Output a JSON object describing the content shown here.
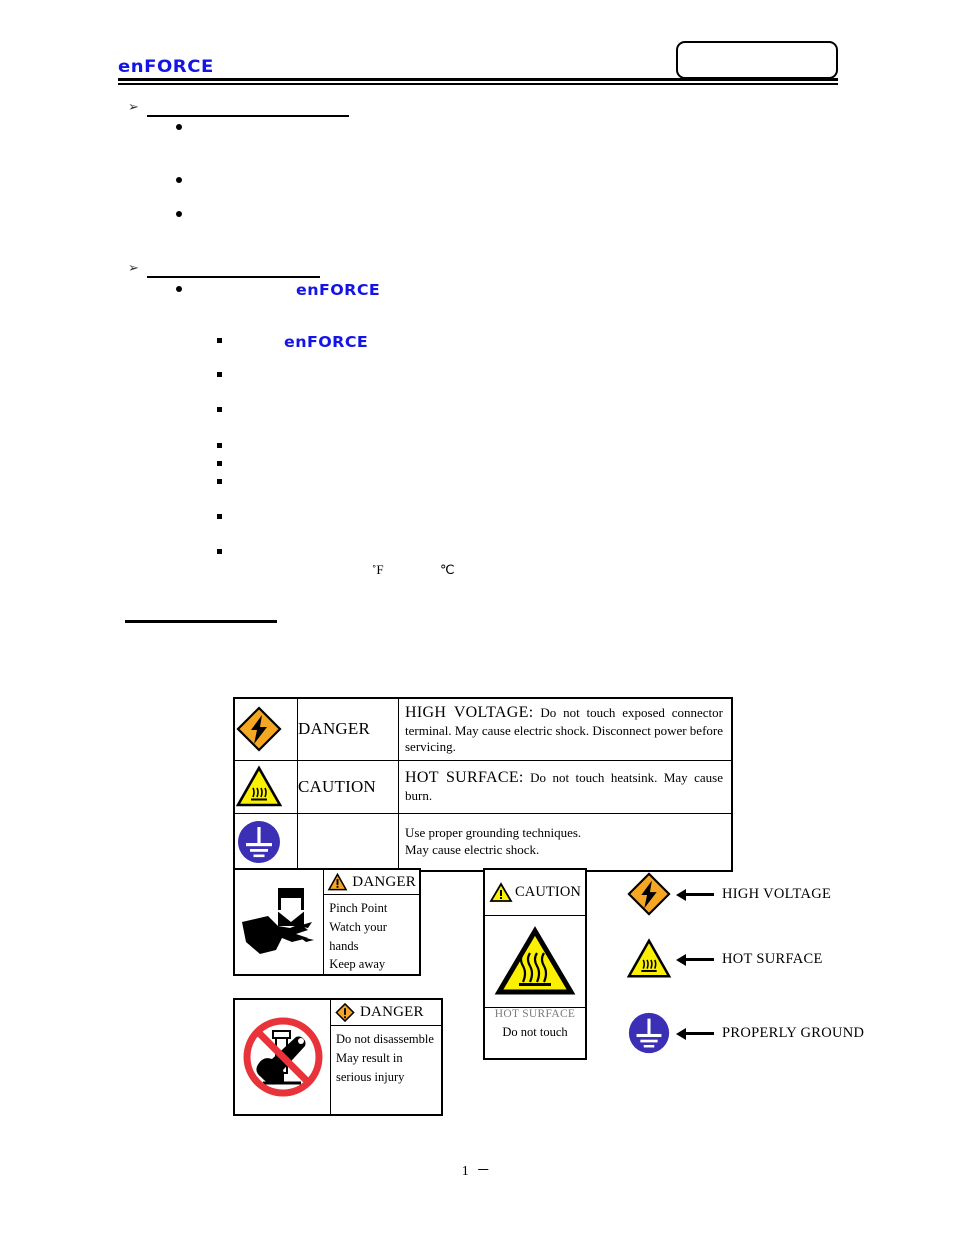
{
  "header": {
    "logo_text": "enFORCE",
    "logo_color": "#1414e6",
    "title_box_value": ""
  },
  "body": {
    "sections": [
      {
        "marker": "➢",
        "heading": "",
        "bullets": [
          {
            "marker": "●",
            "text": ""
          },
          {
            "marker": "●",
            "text": ""
          },
          {
            "marker": "●",
            "text": ""
          }
        ]
      },
      {
        "marker": "➢",
        "heading": "",
        "bullets": [
          {
            "marker": "●",
            "text": "",
            "logo": "enFORCE"
          }
        ],
        "subbullets": [
          {
            "marker": "▪",
            "text": "",
            "logo": "enFORCE"
          },
          {
            "marker": "▪",
            "text": ""
          },
          {
            "marker": "▪",
            "text": ""
          },
          {
            "marker": "▪",
            "text": ""
          },
          {
            "marker": "▪",
            "text": ""
          },
          {
            "marker": "▪",
            "text": ""
          },
          {
            "marker": "▪",
            "text": ""
          },
          {
            "marker": "▪",
            "text": ""
          }
        ]
      }
    ],
    "temperature_units": {
      "fahrenheit": "˚F",
      "celsius": "℃"
    },
    "section_heading_rule": ""
  },
  "warning_table": {
    "rows": [
      {
        "icon": "high-voltage-diamond-icon",
        "signal_word": "DANGER",
        "lead": "HIGH  VOLTAGE:",
        "text": " Do not touch exposed connector terminal. May cause electric shock. Disconnect power before servicing."
      },
      {
        "icon": "hot-surface-triangle-icon",
        "signal_word": "CAUTION",
        "lead": "HOT SURFACE:",
        "text": " Do not touch heatsink. May cause burn."
      },
      {
        "icon": "protective-ground-circle-icon",
        "signal_word": "",
        "lead": "",
        "text_line1": "Use proper grounding techniques.",
        "text_line2": "May cause electric shock."
      }
    ]
  },
  "labels": {
    "pinch": {
      "icon": "pinch-point-hand-icon",
      "signal_icon": "warning-triangle-icon",
      "signal_word": "DANGER",
      "lines": [
        "Pinch Point",
        "Watch your hands",
        "Keep away"
      ]
    },
    "disassemble": {
      "icon": "no-disassembly-icon",
      "signal_icon": "warning-diamond-icon",
      "signal_word": "DANGER",
      "lines": [
        "Do not disassemble",
        "May result in",
        "serious injury"
      ]
    },
    "hot_surface": {
      "signal_icon": "warning-triangle-icon",
      "signal_word": "CAUTION",
      "icon": "hot-surface-triangle-icon",
      "caption_top": "HOT SURFACE",
      "caption_bottom": "Do not touch",
      "caption_top_color": "#7a7a7a"
    }
  },
  "legend": {
    "items": [
      {
        "icon": "high-voltage-diamond-icon",
        "label": "HIGH VOLTAGE"
      },
      {
        "icon": "hot-surface-triangle-icon",
        "label": "HOT SURFACE"
      },
      {
        "icon": "protective-ground-circle-icon",
        "label": "PROPERLY GROUND"
      }
    ]
  },
  "footer": {
    "page_label": "1 －"
  },
  "colors": {
    "logo_blue": "#1414e6",
    "danger_orange": "#f5a623",
    "caution_yellow": "#fbf000",
    "ground_blue": "#3b2fb5",
    "prohibition_red": "#e8333a",
    "rule_black": "#000000"
  }
}
